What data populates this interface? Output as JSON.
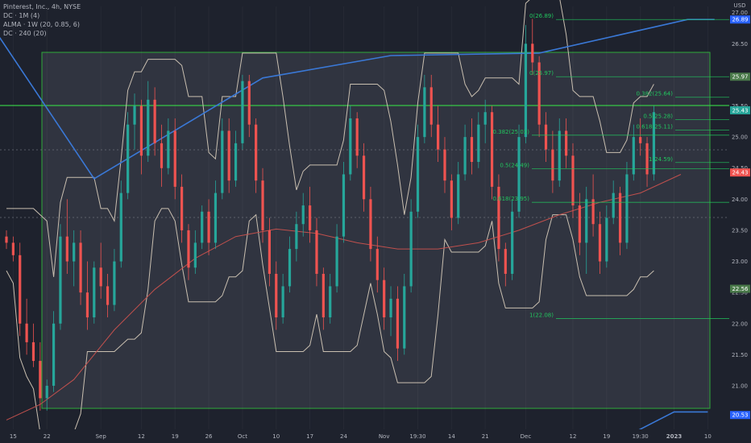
{
  "legend": {
    "title": "Pinterest, Inc., 4h, NYSE",
    "indicators": [
      "DC · 1M (4)",
      "ALMA · 1W (20, 0.85, 6)",
      "DC · 240 (20)"
    ]
  },
  "colors": {
    "background": "#1e222d",
    "up": "#26a69a",
    "down": "#ef5350",
    "donchian_band": "#c9bfb0",
    "alma": "#3a78d6",
    "ma": "#c0504d",
    "fib_green": "#22c55e",
    "axis_text": "#b2b5be"
  },
  "chart_data": {
    "type": "candlestick",
    "title": "Pinterest, Inc., 4h, NYSE",
    "y_axis": {
      "label": "USD",
      "range": [
        20.3,
        27.1
      ],
      "ticks": [
        20.5,
        21.0,
        21.5,
        22.0,
        22.5,
        23.0,
        23.5,
        24.0,
        24.5,
        25.0,
        25.5,
        26.0,
        26.5,
        27.0
      ]
    },
    "x_axis": {
      "range": [
        0,
        103
      ],
      "ticks": [
        {
          "x": 1,
          "label": "15"
        },
        {
          "x": 6,
          "label": "22"
        },
        {
          "x": 14,
          "label": "Sep"
        },
        {
          "x": 20,
          "label": "12"
        },
        {
          "x": 25,
          "label": "19"
        },
        {
          "x": 30,
          "label": "26"
        },
        {
          "x": 35,
          "label": "Oct"
        },
        {
          "x": 40,
          "label": "10"
        },
        {
          "x": 45,
          "label": "17"
        },
        {
          "x": 50,
          "label": "24"
        },
        {
          "x": 56,
          "label": "Nov"
        },
        {
          "x": 61,
          "label": "19:30"
        },
        {
          "x": 66,
          "label": "14"
        },
        {
          "x": 71,
          "label": "21"
        },
        {
          "x": 77,
          "label": "Dec"
        },
        {
          "x": 84,
          "label": "12"
        },
        {
          "x": 89,
          "label": "19"
        },
        {
          "x": 94,
          "label": "19:30"
        },
        {
          "x": 99,
          "label": "2023"
        },
        {
          "x": 104,
          "label": "10"
        }
      ]
    },
    "price_labels": [
      {
        "value": 26.89,
        "label": "26.89",
        "color": "#2962ff"
      },
      {
        "value": 25.97,
        "label": "25.97",
        "color": "#4a7a4a"
      },
      {
        "value": 25.43,
        "label": "25.43",
        "color": "#26a69a"
      },
      {
        "value": 24.43,
        "label": "24.43",
        "color": "#ef5350"
      },
      {
        "value": 22.56,
        "label": "22.56",
        "color": "#4a7a4a"
      },
      {
        "value": 20.53,
        "label": "20.53",
        "color": "#2962ff"
      }
    ],
    "fib_levels": [
      {
        "label": "0(26.89)",
        "value": 26.89
      },
      {
        "label": "0(25.97)",
        "value": 25.97
      },
      {
        "label": "0.382(25.64)",
        "value": 25.64
      },
      {
        "label": "0.5(25.28)",
        "value": 25.28
      },
      {
        "label": "0.618(25.11)",
        "value": 25.11
      },
      {
        "label": "1(24.59)",
        "value": 24.59
      },
      {
        "label": "0.382(25.03)",
        "value": 25.03
      },
      {
        "label": "0.5(24.49)",
        "value": 24.49
      },
      {
        "label": "0.618(23.95)",
        "value": 23.95
      },
      {
        "label": "1(22.08)",
        "value": 22.08
      }
    ],
    "series": [
      {
        "name": "ALMA · 1W (20, 0.85, 6)",
        "type": "line",
        "color": "#3a78d6",
        "points": [
          [
            -1,
            26.6
          ],
          [
            13,
            24.33
          ],
          [
            38,
            25.95
          ],
          [
            57,
            26.31
          ],
          [
            79,
            26.35
          ],
          [
            101,
            26.89
          ],
          [
            105,
            26.89
          ]
        ]
      },
      {
        "name": "ALMA · 1W (20, 0.85, 6)",
        "type": "line",
        "color": "#3a78d6",
        "points": [
          [
            90,
            20.08
          ],
          [
            99,
            20.58
          ],
          [
            104,
            20.58
          ]
        ]
      },
      {
        "name": "MA",
        "type": "line",
        "color": "#c0504d",
        "points": [
          [
            0,
            20.45
          ],
          [
            5,
            20.7
          ],
          [
            10,
            21.1
          ],
          [
            16,
            21.9
          ],
          [
            22,
            22.55
          ],
          [
            28,
            23.05
          ],
          [
            34,
            23.4
          ],
          [
            40,
            23.52
          ],
          [
            46,
            23.45
          ],
          [
            52,
            23.3
          ],
          [
            58,
            23.2
          ],
          [
            64,
            23.2
          ],
          [
            70,
            23.3
          ],
          [
            76,
            23.5
          ],
          [
            82,
            23.75
          ],
          [
            88,
            23.95
          ],
          [
            94,
            24.1
          ],
          [
            100,
            24.4
          ]
        ]
      }
    ],
    "candles": [
      [
        0,
        23.4,
        23.5,
        23.2,
        23.3
      ],
      [
        1,
        23.3,
        23.4,
        23.0,
        23.1
      ],
      [
        2,
        23.1,
        23.3,
        21.8,
        22.0
      ],
      [
        3,
        22.0,
        22.4,
        21.5,
        21.7
      ],
      [
        4,
        21.7,
        22.0,
        21.3,
        21.4
      ],
      [
        5,
        21.4,
        21.7,
        20.6,
        20.8
      ],
      [
        6,
        20.8,
        21.1,
        20.6,
        21.0
      ],
      [
        7,
        21.0,
        22.2,
        20.9,
        22.0
      ],
      [
        8,
        22.0,
        23.6,
        21.9,
        23.4
      ],
      [
        9,
        23.4,
        24.0,
        22.8,
        23.0
      ],
      [
        10,
        23.0,
        23.5,
        22.6,
        23.3
      ],
      [
        11,
        23.3,
        23.5,
        22.3,
        22.5
      ],
      [
        12,
        22.5,
        23.0,
        21.9,
        22.1
      ],
      [
        13,
        22.1,
        23.0,
        22.0,
        22.9
      ],
      [
        14,
        22.9,
        23.3,
        22.4,
        22.6
      ],
      [
        15,
        22.6,
        22.8,
        22.1,
        22.3
      ],
      [
        16,
        22.3,
        23.2,
        22.2,
        23.0
      ],
      [
        17,
        23.0,
        24.3,
        22.9,
        24.1
      ],
      [
        18,
        24.1,
        25.4,
        24.0,
        25.2
      ],
      [
        19,
        25.2,
        25.7,
        24.8,
        25.5
      ],
      [
        20,
        25.5,
        25.6,
        24.4,
        24.7
      ],
      [
        21,
        24.7,
        25.9,
        24.6,
        25.6
      ],
      [
        22,
        25.6,
        25.8,
        24.7,
        24.9
      ],
      [
        23,
        24.9,
        25.2,
        24.2,
        24.5
      ],
      [
        24,
        24.5,
        25.3,
        24.4,
        25.1
      ],
      [
        25,
        25.1,
        25.3,
        24.0,
        24.2
      ],
      [
        26,
        24.2,
        24.4,
        23.3,
        23.5
      ],
      [
        27,
        23.5,
        23.6,
        22.7,
        22.9
      ],
      [
        28,
        22.9,
        23.5,
        22.8,
        23.3
      ],
      [
        29,
        23.3,
        23.9,
        23.2,
        23.8
      ],
      [
        30,
        23.8,
        24.0,
        23.1,
        23.3
      ],
      [
        31,
        23.3,
        24.3,
        23.2,
        24.1
      ],
      [
        32,
        24.1,
        25.3,
        24.0,
        25.1
      ],
      [
        33,
        25.1,
        25.3,
        24.1,
        24.3
      ],
      [
        34,
        24.3,
        25.1,
        24.2,
        24.9
      ],
      [
        35,
        24.9,
        26.0,
        24.8,
        25.9
      ],
      [
        36,
        25.9,
        26.0,
        25.0,
        25.2
      ],
      [
        37,
        25.2,
        25.3,
        24.1,
        24.3
      ],
      [
        38,
        24.3,
        24.5,
        23.3,
        23.5
      ],
      [
        39,
        23.5,
        23.7,
        22.6,
        22.8
      ],
      [
        40,
        22.8,
        23.0,
        21.9,
        22.1
      ],
      [
        41,
        22.1,
        22.8,
        22.0,
        22.6
      ],
      [
        42,
        22.6,
        23.4,
        22.5,
        23.2
      ],
      [
        43,
        23.2,
        23.8,
        23.0,
        23.6
      ],
      [
        44,
        23.6,
        24.1,
        23.4,
        23.9
      ],
      [
        45,
        23.9,
        24.2,
        23.3,
        23.5
      ],
      [
        46,
        23.5,
        23.7,
        22.6,
        22.8
      ],
      [
        47,
        22.8,
        22.9,
        21.9,
        22.1
      ],
      [
        48,
        22.1,
        22.8,
        22.0,
        22.6
      ],
      [
        49,
        22.6,
        23.6,
        22.5,
        23.4
      ],
      [
        50,
        23.4,
        24.6,
        23.3,
        24.4
      ],
      [
        51,
        24.4,
        25.5,
        24.3,
        25.3
      ],
      [
        52,
        25.3,
        25.4,
        24.5,
        24.7
      ],
      [
        53,
        24.7,
        24.9,
        23.8,
        24.0
      ],
      [
        54,
        24.0,
        24.2,
        23.0,
        23.2
      ],
      [
        55,
        23.2,
        23.4,
        22.5,
        22.7
      ],
      [
        56,
        22.7,
        22.9,
        21.9,
        22.1
      ],
      [
        57,
        22.1,
        22.6,
        21.8,
        22.4
      ],
      [
        58,
        22.4,
        22.6,
        21.4,
        21.6
      ],
      [
        59,
        21.6,
        22.8,
        21.5,
        22.6
      ],
      [
        60,
        22.6,
        24.0,
        22.5,
        23.8
      ],
      [
        61,
        23.8,
        25.2,
        23.7,
        25.0
      ],
      [
        62,
        25.0,
        26.0,
        24.9,
        25.8
      ],
      [
        63,
        25.8,
        26.0,
        25.0,
        25.2
      ],
      [
        64,
        25.2,
        25.5,
        24.6,
        24.8
      ],
      [
        65,
        24.8,
        25.0,
        24.1,
        24.3
      ],
      [
        66,
        24.3,
        24.4,
        23.5,
        23.7
      ],
      [
        67,
        23.7,
        24.6,
        23.6,
        24.4
      ],
      [
        68,
        24.4,
        25.2,
        24.3,
        25.0
      ],
      [
        69,
        25.0,
        25.3,
        24.4,
        24.6
      ],
      [
        70,
        24.6,
        25.4,
        24.5,
        25.2
      ],
      [
        71,
        25.2,
        25.6,
        24.9,
        25.4
      ],
      [
        72,
        25.4,
        25.5,
        24.0,
        24.2
      ],
      [
        73,
        24.2,
        24.4,
        23.0,
        23.2
      ],
      [
        74,
        23.2,
        23.3,
        22.6,
        22.8
      ],
      [
        75,
        22.8,
        24.0,
        22.7,
        23.8
      ],
      [
        76,
        23.8,
        25.2,
        23.7,
        25.0
      ],
      [
        77,
        25.0,
        26.8,
        24.9,
        26.5
      ],
      [
        78,
        26.5,
        26.9,
        26.0,
        26.2
      ],
      [
        79,
        26.2,
        26.3,
        25.0,
        25.2
      ],
      [
        80,
        25.2,
        25.4,
        24.6,
        24.8
      ],
      [
        81,
        24.8,
        25.1,
        24.1,
        24.3
      ],
      [
        82,
        24.3,
        25.3,
        24.2,
        25.1
      ],
      [
        83,
        25.1,
        25.3,
        24.5,
        24.7
      ],
      [
        84,
        24.7,
        24.9,
        23.7,
        23.9
      ],
      [
        85,
        23.9,
        24.1,
        23.1,
        23.3
      ],
      [
        86,
        23.3,
        24.2,
        22.8,
        24.0
      ],
      [
        87,
        24.0,
        24.4,
        23.4,
        23.6
      ],
      [
        88,
        23.6,
        23.8,
        22.8,
        23.0
      ],
      [
        89,
        23.0,
        23.9,
        22.9,
        23.7
      ],
      [
        90,
        23.7,
        24.3,
        23.6,
        24.1
      ],
      [
        91,
        24.1,
        24.2,
        23.1,
        23.3
      ],
      [
        92,
        23.3,
        24.6,
        23.2,
        24.4
      ],
      [
        93,
        24.4,
        25.2,
        24.3,
        25.0
      ],
      [
        94,
        25.0,
        25.3,
        24.7,
        24.9
      ],
      [
        95,
        24.9,
        25.0,
        24.2,
        24.4
      ],
      [
        96,
        24.4,
        25.5,
        24.3,
        25.4
      ]
    ]
  }
}
